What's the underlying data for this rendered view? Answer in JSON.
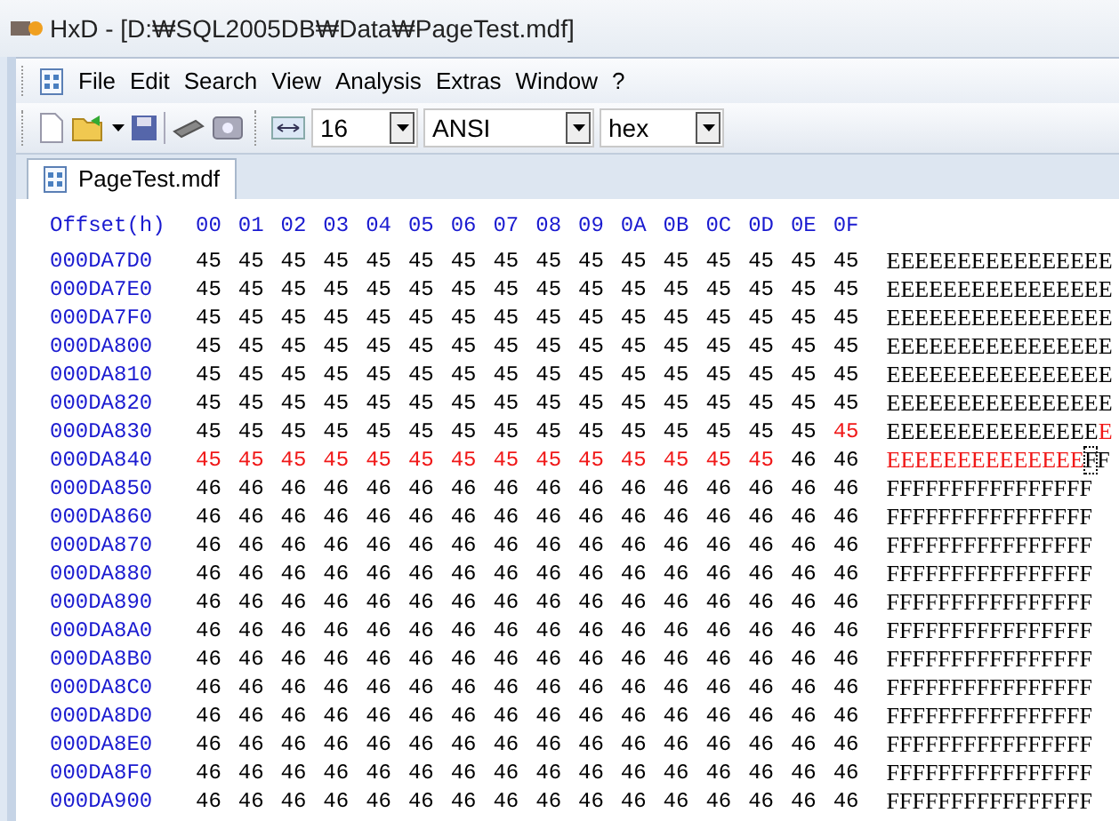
{
  "window": {
    "title": "HxD - [D:₩SQL2005DB₩Data₩PageTest.mdf]"
  },
  "menu": [
    "File",
    "Edit",
    "Search",
    "View",
    "Analysis",
    "Extras",
    "Window",
    "?"
  ],
  "toolbar": {
    "bytes_per_row": "16",
    "charset": "ANSI",
    "offset_base": "hex"
  },
  "tabs": [
    {
      "label": "PageTest.mdf",
      "selected": true
    }
  ],
  "header": {
    "offset": "Offset(h)",
    "columns": [
      "00",
      "01",
      "02",
      "03",
      "04",
      "05",
      "06",
      "07",
      "08",
      "09",
      "0A",
      "0B",
      "0C",
      "0D",
      "0E",
      "0F"
    ]
  },
  "rows": [
    {
      "offset": "000DA7D0",
      "bytes": [
        {
          "values": [
            "45",
            "45",
            "45",
            "45",
            "45",
            "45",
            "45",
            "45",
            "45",
            "45",
            "45",
            "45",
            "45",
            "45",
            "45",
            "45"
          ],
          "selected": false
        }
      ],
      "text": [
        {
          "text": "EEEEEEEEEEEEEEEE",
          "selected": false,
          "cursor": false
        }
      ]
    },
    {
      "offset": "000DA7E0",
      "bytes": [
        {
          "values": [
            "45",
            "45",
            "45",
            "45",
            "45",
            "45",
            "45",
            "45",
            "45",
            "45",
            "45",
            "45",
            "45",
            "45",
            "45",
            "45"
          ],
          "selected": false
        }
      ],
      "text": [
        {
          "text": "EEEEEEEEEEEEEEEE",
          "selected": false,
          "cursor": false
        }
      ]
    },
    {
      "offset": "000DA7F0",
      "bytes": [
        {
          "values": [
            "45",
            "45",
            "45",
            "45",
            "45",
            "45",
            "45",
            "45",
            "45",
            "45",
            "45",
            "45",
            "45",
            "45",
            "45",
            "45"
          ],
          "selected": false
        }
      ],
      "text": [
        {
          "text": "EEEEEEEEEEEEEEEE",
          "selected": false,
          "cursor": false
        }
      ]
    },
    {
      "offset": "000DA800",
      "bytes": [
        {
          "values": [
            "45",
            "45",
            "45",
            "45",
            "45",
            "45",
            "45",
            "45",
            "45",
            "45",
            "45",
            "45",
            "45",
            "45",
            "45",
            "45"
          ],
          "selected": false
        }
      ],
      "text": [
        {
          "text": "EEEEEEEEEEEEEEEE",
          "selected": false,
          "cursor": false
        }
      ]
    },
    {
      "offset": "000DA810",
      "bytes": [
        {
          "values": [
            "45",
            "45",
            "45",
            "45",
            "45",
            "45",
            "45",
            "45",
            "45",
            "45",
            "45",
            "45",
            "45",
            "45",
            "45",
            "45"
          ],
          "selected": false
        }
      ],
      "text": [
        {
          "text": "EEEEEEEEEEEEEEEE",
          "selected": false,
          "cursor": false
        }
      ]
    },
    {
      "offset": "000DA820",
      "bytes": [
        {
          "values": [
            "45",
            "45",
            "45",
            "45",
            "45",
            "45",
            "45",
            "45",
            "45",
            "45",
            "45",
            "45",
            "45",
            "45",
            "45",
            "45"
          ],
          "selected": false
        }
      ],
      "text": [
        {
          "text": "EEEEEEEEEEEEEEEE",
          "selected": false,
          "cursor": false
        }
      ]
    },
    {
      "offset": "000DA830",
      "bytes": [
        {
          "values": [
            "45",
            "45",
            "45",
            "45",
            "45",
            "45",
            "45",
            "45",
            "45",
            "45",
            "45",
            "45",
            "45",
            "45",
            "45"
          ],
          "selected": false
        },
        {
          "values": [
            "45"
          ],
          "selected": true
        }
      ],
      "text": [
        {
          "text": "EEEEEEEEEEEEEEE",
          "selected": false,
          "cursor": false
        },
        {
          "text": "E",
          "selected": true,
          "cursor": false
        }
      ]
    },
    {
      "offset": "000DA840",
      "bytes": [
        {
          "values": [
            "45",
            "45",
            "45",
            "45",
            "45",
            "45",
            "45",
            "45",
            "45",
            "45",
            "45",
            "45",
            "45",
            "45"
          ],
          "selected": true
        },
        {
          "values": [
            "46",
            "46"
          ],
          "selected": false
        }
      ],
      "text": [
        {
          "text": "EEEEEEEEEEEEEE",
          "selected": true,
          "cursor": false
        },
        {
          "text": "F",
          "selected": false,
          "cursor": true
        },
        {
          "text": "F",
          "selected": false,
          "cursor": false
        }
      ]
    },
    {
      "offset": "000DA850",
      "bytes": [
        {
          "values": [
            "46",
            "46",
            "46",
            "46",
            "46",
            "46",
            "46",
            "46",
            "46",
            "46",
            "46",
            "46",
            "46",
            "46",
            "46",
            "46"
          ],
          "selected": false
        }
      ],
      "text": [
        {
          "text": "FFFFFFFFFFFFFFFF",
          "selected": false,
          "cursor": false
        }
      ]
    },
    {
      "offset": "000DA860",
      "bytes": [
        {
          "values": [
            "46",
            "46",
            "46",
            "46",
            "46",
            "46",
            "46",
            "46",
            "46",
            "46",
            "46",
            "46",
            "46",
            "46",
            "46",
            "46"
          ],
          "selected": false
        }
      ],
      "text": [
        {
          "text": "FFFFFFFFFFFFFFFF",
          "selected": false,
          "cursor": false
        }
      ]
    },
    {
      "offset": "000DA870",
      "bytes": [
        {
          "values": [
            "46",
            "46",
            "46",
            "46",
            "46",
            "46",
            "46",
            "46",
            "46",
            "46",
            "46",
            "46",
            "46",
            "46",
            "46",
            "46"
          ],
          "selected": false
        }
      ],
      "text": [
        {
          "text": "FFFFFFFFFFFFFFFF",
          "selected": false,
          "cursor": false
        }
      ]
    },
    {
      "offset": "000DA880",
      "bytes": [
        {
          "values": [
            "46",
            "46",
            "46",
            "46",
            "46",
            "46",
            "46",
            "46",
            "46",
            "46",
            "46",
            "46",
            "46",
            "46",
            "46",
            "46"
          ],
          "selected": false
        }
      ],
      "text": [
        {
          "text": "FFFFFFFFFFFFFFFF",
          "selected": false,
          "cursor": false
        }
      ]
    },
    {
      "offset": "000DA890",
      "bytes": [
        {
          "values": [
            "46",
            "46",
            "46",
            "46",
            "46",
            "46",
            "46",
            "46",
            "46",
            "46",
            "46",
            "46",
            "46",
            "46",
            "46",
            "46"
          ],
          "selected": false
        }
      ],
      "text": [
        {
          "text": "FFFFFFFFFFFFFFFF",
          "selected": false,
          "cursor": false
        }
      ]
    },
    {
      "offset": "000DA8A0",
      "bytes": [
        {
          "values": [
            "46",
            "46",
            "46",
            "46",
            "46",
            "46",
            "46",
            "46",
            "46",
            "46",
            "46",
            "46",
            "46",
            "46",
            "46",
            "46"
          ],
          "selected": false
        }
      ],
      "text": [
        {
          "text": "FFFFFFFFFFFFFFFF",
          "selected": false,
          "cursor": false
        }
      ]
    },
    {
      "offset": "000DA8B0",
      "bytes": [
        {
          "values": [
            "46",
            "46",
            "46",
            "46",
            "46",
            "46",
            "46",
            "46",
            "46",
            "46",
            "46",
            "46",
            "46",
            "46",
            "46",
            "46"
          ],
          "selected": false
        }
      ],
      "text": [
        {
          "text": "FFFFFFFFFFFFFFFF",
          "selected": false,
          "cursor": false
        }
      ]
    },
    {
      "offset": "000DA8C0",
      "bytes": [
        {
          "values": [
            "46",
            "46",
            "46",
            "46",
            "46",
            "46",
            "46",
            "46",
            "46",
            "46",
            "46",
            "46",
            "46",
            "46",
            "46",
            "46"
          ],
          "selected": false
        }
      ],
      "text": [
        {
          "text": "FFFFFFFFFFFFFFFF",
          "selected": false,
          "cursor": false
        }
      ]
    },
    {
      "offset": "000DA8D0",
      "bytes": [
        {
          "values": [
            "46",
            "46",
            "46",
            "46",
            "46",
            "46",
            "46",
            "46",
            "46",
            "46",
            "46",
            "46",
            "46",
            "46",
            "46",
            "46"
          ],
          "selected": false
        }
      ],
      "text": [
        {
          "text": "FFFFFFFFFFFFFFFF",
          "selected": false,
          "cursor": false
        }
      ]
    },
    {
      "offset": "000DA8E0",
      "bytes": [
        {
          "values": [
            "46",
            "46",
            "46",
            "46",
            "46",
            "46",
            "46",
            "46",
            "46",
            "46",
            "46",
            "46",
            "46",
            "46",
            "46",
            "46"
          ],
          "selected": false
        }
      ],
      "text": [
        {
          "text": "FFFFFFFFFFFFFFFF",
          "selected": false,
          "cursor": false
        }
      ]
    },
    {
      "offset": "000DA8F0",
      "bytes": [
        {
          "values": [
            "46",
            "46",
            "46",
            "46",
            "46",
            "46",
            "46",
            "46",
            "46",
            "46",
            "46",
            "46",
            "46",
            "46",
            "46",
            "46"
          ],
          "selected": false
        }
      ],
      "text": [
        {
          "text": "FFFFFFFFFFFFFFFF",
          "selected": false,
          "cursor": false
        }
      ]
    },
    {
      "offset": "000DA900",
      "bytes": [
        {
          "values": [
            "46",
            "46",
            "46",
            "46",
            "46",
            "46",
            "46",
            "46",
            "46",
            "46",
            "46",
            "46",
            "46",
            "46",
            "46",
            "46"
          ],
          "selected": false
        }
      ],
      "text": [
        {
          "text": "FFFFFFFFFFFFFFFF",
          "selected": false,
          "cursor": false
        }
      ]
    }
  ]
}
